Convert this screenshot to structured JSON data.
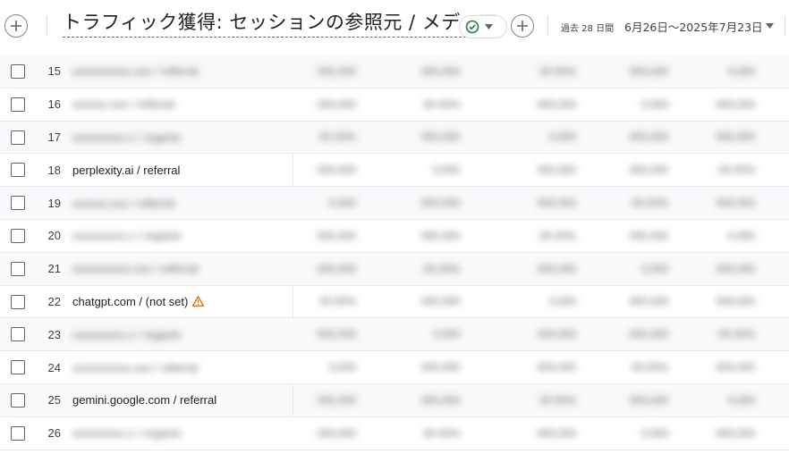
{
  "header": {
    "add_comparison_icon": "plus-circle-icon",
    "title": "トラフィック獲得: セッションの参照元 / メディア",
    "status_icon": "check-circle-icon",
    "status_color": "#188038",
    "add_icon": "plus-circle-icon",
    "date_prefix": "過去 28 日間",
    "date_range": "6月26日〜2025年7月23日"
  },
  "table": {
    "rows": [
      {
        "num": "15",
        "source": "",
        "blurred": true,
        "metrics": [
          "",
          "",
          "",
          "",
          ""
        ]
      },
      {
        "num": "16",
        "source": "",
        "blurred": true,
        "metrics": [
          "",
          "",
          "",
          "",
          ""
        ]
      },
      {
        "num": "17",
        "source": "",
        "blurred": true,
        "metrics": [
          "",
          "",
          "",
          "",
          ""
        ]
      },
      {
        "num": "18",
        "source": "perplexity.ai / referral",
        "blurred": false,
        "metrics": [
          "",
          "",
          "",
          "",
          ""
        ]
      },
      {
        "num": "19",
        "source": "",
        "blurred": true,
        "metrics": [
          "",
          "",
          "",
          "",
          ""
        ]
      },
      {
        "num": "20",
        "source": "",
        "blurred": true,
        "metrics": [
          "",
          "",
          "",
          "",
          ""
        ]
      },
      {
        "num": "21",
        "source": "",
        "blurred": true,
        "metrics": [
          "",
          "",
          "",
          "",
          ""
        ]
      },
      {
        "num": "22",
        "source": "chatgpt.com / (not set)",
        "blurred": false,
        "warning": true,
        "metrics": [
          "",
          "",
          "",
          "",
          ""
        ]
      },
      {
        "num": "23",
        "source": "",
        "blurred": true,
        "metrics": [
          "",
          "",
          "",
          "",
          ""
        ]
      },
      {
        "num": "24",
        "source": "",
        "blurred": true,
        "metrics": [
          "",
          "",
          "",
          "",
          ""
        ]
      },
      {
        "num": "25",
        "source": "gemini.google.com / referral",
        "blurred": false,
        "metrics": [
          "",
          "",
          "",
          "",
          ""
        ]
      },
      {
        "num": "26",
        "source": "",
        "blurred": true,
        "metrics": [
          "",
          "",
          "",
          "",
          ""
        ]
      }
    ],
    "warning_icon": "warning-triangle-icon",
    "warning_color": "#e37400"
  }
}
